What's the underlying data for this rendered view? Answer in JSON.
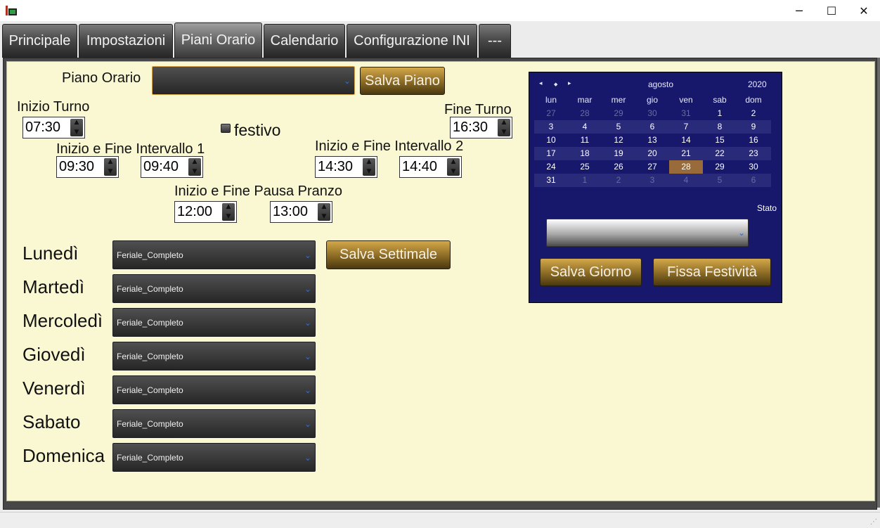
{
  "window": {
    "minimize_glyph": "─",
    "maximize_glyph": "☐",
    "close_glyph": "✕"
  },
  "tabs": [
    {
      "label": "Principale"
    },
    {
      "label": "Impostazioni"
    },
    {
      "label": "Piani Orario"
    },
    {
      "label": "Calendario"
    },
    {
      "label": "Configurazione INI"
    },
    {
      "label": "---"
    }
  ],
  "active_tab": "Piani Orario",
  "piano": {
    "label": "Piano Orario",
    "value": "",
    "save_label": "Salva Piano"
  },
  "turno": {
    "inizio_label": "Inizio Turno",
    "inizio_value": "07:30",
    "fine_label": "Fine Turno",
    "fine_value": "16:30",
    "festivo_label": "festivo",
    "festivo_checked": false
  },
  "intervallo1": {
    "label": "Inizio e Fine Intervallo 1",
    "start": "09:30",
    "end": "09:40"
  },
  "intervallo2": {
    "label": "Inizio e Fine Intervallo 2",
    "start": "14:30",
    "end": "14:40"
  },
  "pausa": {
    "label": "Inizio e Fine Pausa Pranzo",
    "start": "12:00",
    "end": "13:00"
  },
  "settimana": {
    "save_label": "Salva Settimale",
    "days": [
      {
        "label": "Lunedì",
        "value": "Feriale_Completo"
      },
      {
        "label": "Martedì",
        "value": "Feriale_Completo"
      },
      {
        "label": "Mercoledì",
        "value": "Feriale_Completo"
      },
      {
        "label": "Giovedì",
        "value": "Feriale_Completo"
      },
      {
        "label": "Venerdì",
        "value": "Feriale_Completo"
      },
      {
        "label": "Sabato",
        "value": "Feriale_Completo"
      },
      {
        "label": "Domenica",
        "value": "Feriale_Completo"
      }
    ]
  },
  "calendar": {
    "nav_prev": "◂",
    "nav_today": "◆",
    "nav_next": "▸",
    "month": "agosto",
    "year": "2020",
    "dow": [
      "lun",
      "mar",
      "mer",
      "gio",
      "ven",
      "sab",
      "dom"
    ],
    "weeks": [
      [
        {
          "d": "27",
          "o": true
        },
        {
          "d": "28",
          "o": true
        },
        {
          "d": "29",
          "o": true
        },
        {
          "d": "30",
          "o": true
        },
        {
          "d": "31",
          "o": true
        },
        {
          "d": "1",
          "o": false
        },
        {
          "d": "2",
          "o": false
        }
      ],
      [
        {
          "d": "3",
          "o": false
        },
        {
          "d": "4",
          "o": false
        },
        {
          "d": "5",
          "o": false
        },
        {
          "d": "6",
          "o": false
        },
        {
          "d": "7",
          "o": false
        },
        {
          "d": "8",
          "o": false
        },
        {
          "d": "9",
          "o": false
        }
      ],
      [
        {
          "d": "10",
          "o": false
        },
        {
          "d": "11",
          "o": false
        },
        {
          "d": "12",
          "o": false
        },
        {
          "d": "13",
          "o": false
        },
        {
          "d": "14",
          "o": false
        },
        {
          "d": "15",
          "o": false
        },
        {
          "d": "16",
          "o": false
        }
      ],
      [
        {
          "d": "17",
          "o": false
        },
        {
          "d": "18",
          "o": false
        },
        {
          "d": "19",
          "o": false
        },
        {
          "d": "20",
          "o": false
        },
        {
          "d": "21",
          "o": false
        },
        {
          "d": "22",
          "o": false
        },
        {
          "d": "23",
          "o": false
        }
      ],
      [
        {
          "d": "24",
          "o": false
        },
        {
          "d": "25",
          "o": false
        },
        {
          "d": "26",
          "o": false
        },
        {
          "d": "27",
          "o": false
        },
        {
          "d": "28",
          "o": false
        },
        {
          "d": "29",
          "o": false
        },
        {
          "d": "30",
          "o": false
        }
      ],
      [
        {
          "d": "31",
          "o": false
        },
        {
          "d": "1",
          "o": true
        },
        {
          "d": "2",
          "o": true
        },
        {
          "d": "3",
          "o": true
        },
        {
          "d": "4",
          "o": true
        },
        {
          "d": "5",
          "o": true
        },
        {
          "d": "6",
          "o": true
        }
      ]
    ],
    "selected_day": "28",
    "stato_label": "Stato",
    "stato_value": "",
    "save_day_label": "Salva Giorno",
    "fix_holidays_label": "Fissa Festività"
  },
  "colors": {
    "panel_bg": "#f9f8d3",
    "calendar_bg": "#17186b",
    "selected_day_bg": "#9a6b3a",
    "gold_button": "#8a6a24"
  }
}
